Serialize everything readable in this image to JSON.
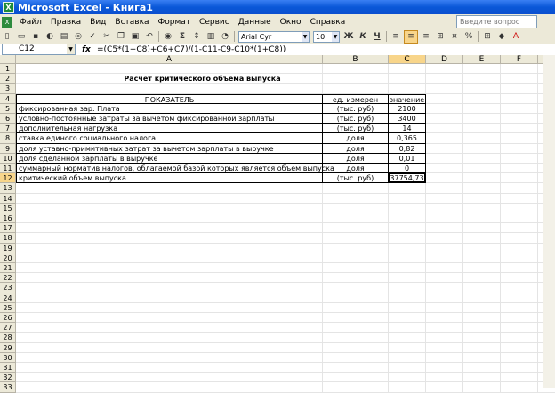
{
  "window": {
    "title": "Microsoft Excel - Книга1",
    "app_icon": "excel-icon"
  },
  "menu": {
    "items": [
      "Файл",
      "Правка",
      "Вид",
      "Вставка",
      "Формат",
      "Сервис",
      "Данные",
      "Окно",
      "Справка"
    ],
    "help_placeholder": "Введите вопрос"
  },
  "toolbar": {
    "font_name": "Arial Cyr",
    "font_size": "10",
    "bold": "Ж",
    "italic": "К",
    "underline": "Ч",
    "sum": "Σ"
  },
  "formula_bar": {
    "name_box": "C12",
    "fx_label": "fx",
    "formula": "=(C5*(1+C8)+C6+C7)/(1-C11-C9-C10*(1+C8))"
  },
  "columns": [
    "A",
    "B",
    "C",
    "D",
    "E",
    "F",
    "G"
  ],
  "rows": [
    "1",
    "2",
    "3",
    "4",
    "5",
    "6",
    "7",
    "8",
    "9",
    "10",
    "11",
    "12",
    "13",
    "14",
    "15",
    "16",
    "17",
    "18",
    "19",
    "20",
    "21",
    "22",
    "23",
    "24",
    "25",
    "26",
    "27",
    "28",
    "29",
    "30",
    "31",
    "32",
    "33"
  ],
  "sheet": {
    "title": "Расчет критического объема выпуска",
    "headers": {
      "indicator": "ПОКАЗАТЕЛЬ",
      "unit": "ед. измерен",
      "value": "значение"
    },
    "table": [
      {
        "name": "фиксированная зар. Плата",
        "unit": "(тыс. руб)",
        "value": "2100"
      },
      {
        "name": "условно-постоянные затраты за вычетом фиксированной зарплаты",
        "unit": "(тыс. руб)",
        "value": "3400"
      },
      {
        "name": "дополнительная нагрузка",
        "unit": "(тыс. руб)",
        "value": "14"
      },
      {
        "name": "ставка единого социального налога",
        "unit": "доля",
        "value": "0,365"
      },
      {
        "name": "доля уставно-примитивных затрат за вычетом зарплаты в выручке",
        "unit": "доля",
        "value": "0,82"
      },
      {
        "name": "доля сделанной зарплаты в выручке",
        "unit": "доля",
        "value": "0,01"
      },
      {
        "name": "суммарный норматив налогов, облагаемой базой которых является объем выпуска",
        "unit": "доля",
        "value": "0"
      },
      {
        "name": "критический объем выпуска",
        "unit": "(тыс. руб)",
        "value": "37754,73"
      }
    ]
  }
}
